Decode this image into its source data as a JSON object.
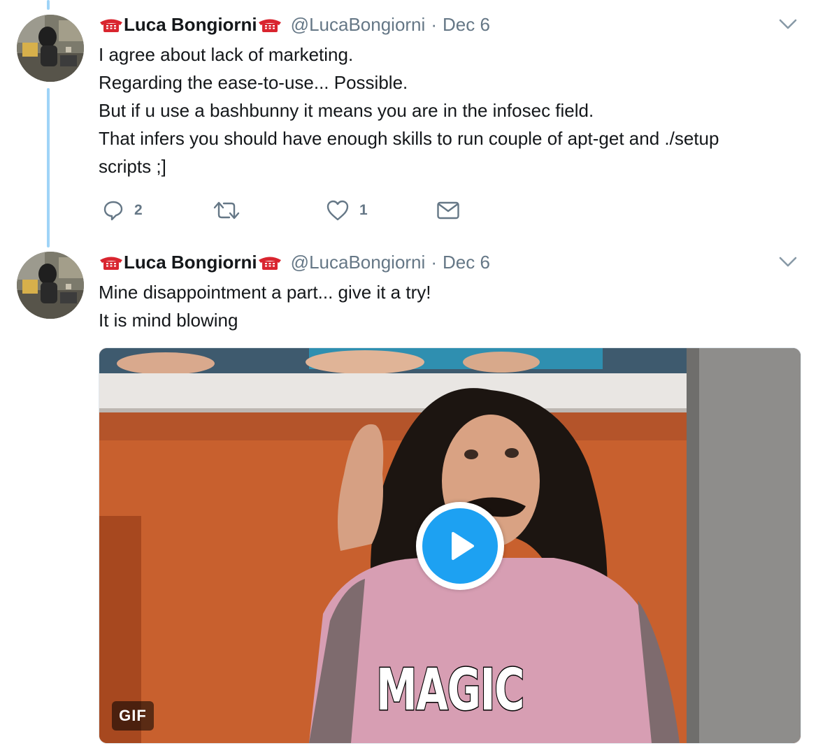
{
  "tweets": [
    {
      "display_name": "Luca Bongiorni",
      "screen_name": "@LucaBongiorni",
      "separator": "·",
      "date": "Dec 6",
      "text_lines": [
        "I agree about lack of marketing.",
        "Regarding the ease-to-use... Possible.",
        "But if u use a bashbunny it means you are in the infosec field.",
        "That infers you should have enough skills to run couple of apt-get and ./setup",
        "scripts ;]"
      ],
      "actions": {
        "reply_count": "2",
        "retweet_count": "",
        "like_count": "1"
      }
    },
    {
      "display_name": "Luca Bongiorni",
      "screen_name": "@LucaBongiorni",
      "separator": "·",
      "date": "Dec 6",
      "text_lines": [
        "Mine disappointment a part... give it a try!",
        "It is mind blowing"
      ],
      "media": {
        "type": "gif",
        "badge": "GIF",
        "caption": "MAGIC"
      }
    }
  ],
  "icons": {
    "name_emoji": "telephone-emoji-icon",
    "caret": "chevron-down-icon",
    "reply": "reply-icon",
    "retweet": "retweet-icon",
    "like": "heart-icon",
    "dm": "envelope-icon",
    "play": "play-icon"
  },
  "colors": {
    "thread_line": "#9fd4f7",
    "accent": "#1da1f2",
    "secondary_text": "#657786",
    "primary_text": "#14171a",
    "emoji_red": "#d9252f"
  }
}
